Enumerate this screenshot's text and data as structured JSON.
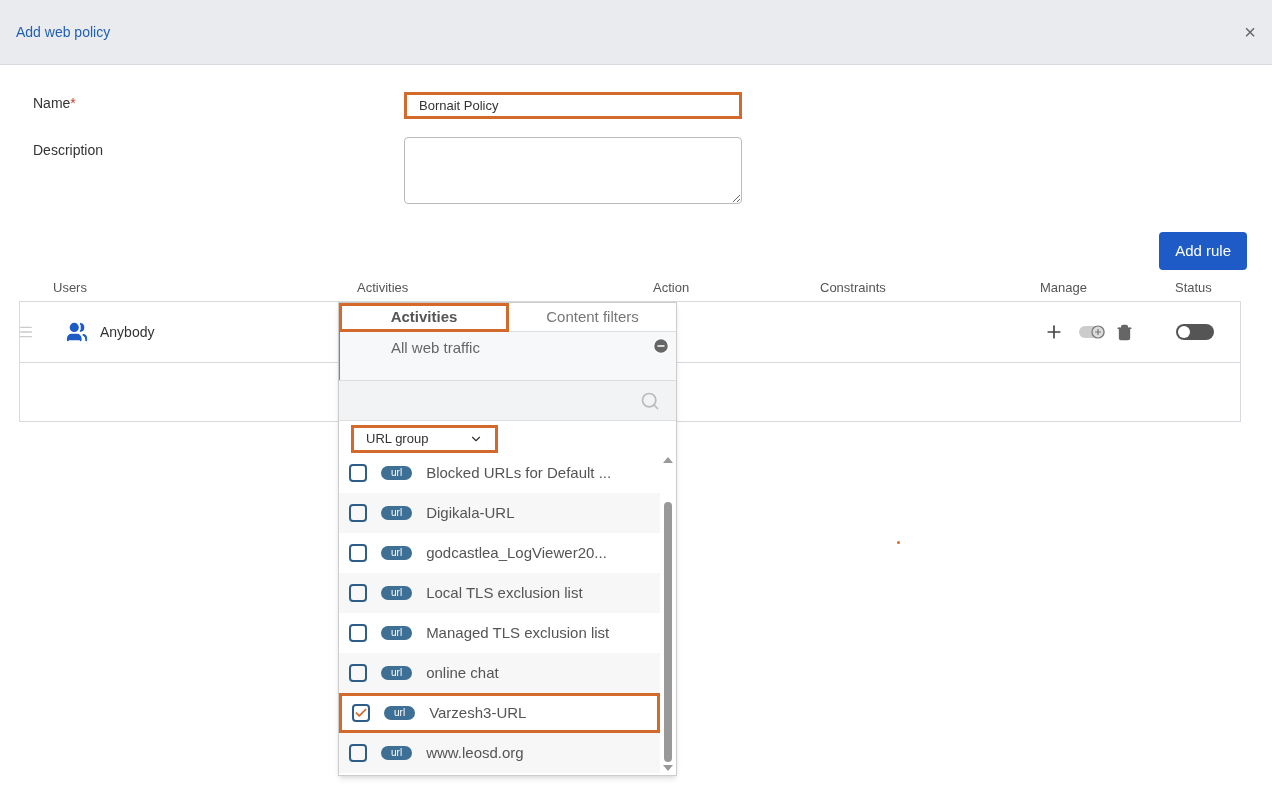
{
  "dialog": {
    "title": "Add web policy",
    "close": "×"
  },
  "form": {
    "name_label": "Name",
    "required_mark": "*",
    "name_value": "Bornait Policy",
    "name_highlighted": true,
    "description_label": "Description"
  },
  "add_rule": "Add rule",
  "table": {
    "columns": [
      "Users",
      "Activities",
      "Action",
      "Constraints",
      "Manage",
      "Status"
    ],
    "rows": [
      {
        "user": "Anybody",
        "status_on": false
      }
    ]
  },
  "activity_popup": {
    "tabs": [
      {
        "label": "Activities",
        "selected": true,
        "highlighted": true
      },
      {
        "label": "Content filters",
        "selected": false,
        "highlighted": false
      }
    ],
    "current": "All web traffic",
    "filter": {
      "value": "URL group",
      "highlighted": true
    },
    "items": [
      {
        "badge": "url",
        "label": "Blocked URLs for Default ...",
        "checked": false,
        "highlighted": false
      },
      {
        "badge": "url",
        "label": "Digikala-URL",
        "checked": false,
        "highlighted": false
      },
      {
        "badge": "url",
        "label": "godcastlea_LogViewer20...",
        "checked": false,
        "highlighted": false
      },
      {
        "badge": "url",
        "label": "Local TLS exclusion list",
        "checked": false,
        "highlighted": false
      },
      {
        "badge": "url",
        "label": "Managed TLS exclusion list",
        "checked": false,
        "highlighted": false
      },
      {
        "badge": "url",
        "label": "online chat",
        "checked": false,
        "highlighted": false
      },
      {
        "badge": "url",
        "label": "Varzesh3-URL",
        "checked": true,
        "highlighted": true
      },
      {
        "badge": "url",
        "label": "www.leosd.org",
        "checked": false,
        "highlighted": false
      }
    ]
  }
}
